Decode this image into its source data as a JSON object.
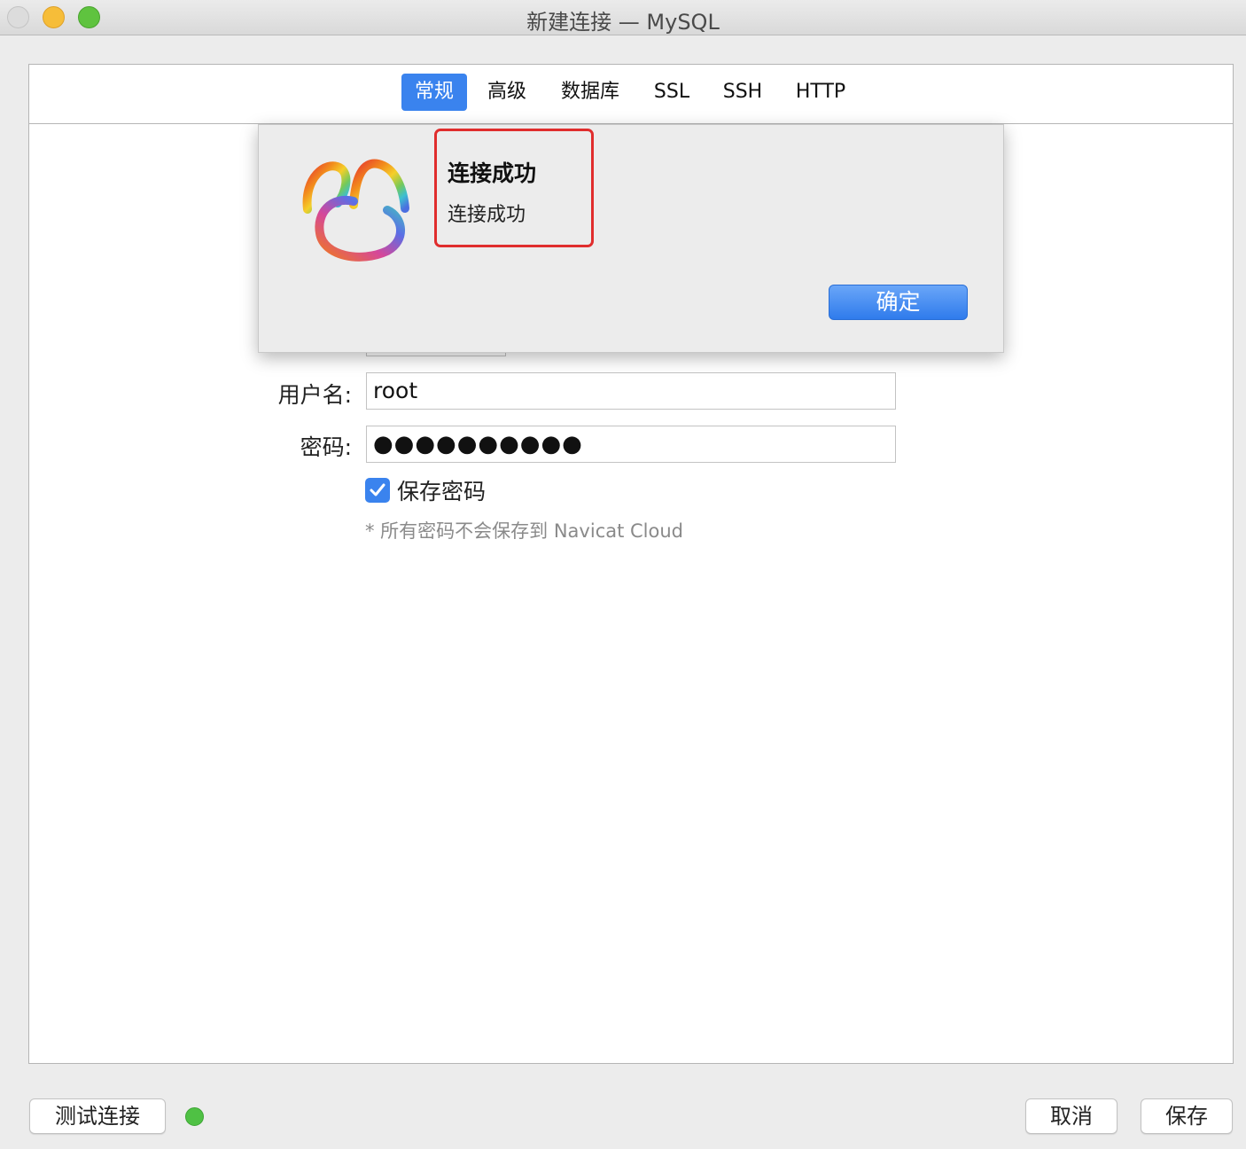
{
  "window": {
    "title": "新建连接 — MySQL"
  },
  "tabs": [
    {
      "label": "常规",
      "active": true
    },
    {
      "label": "高级",
      "active": false
    },
    {
      "label": "数据库",
      "active": false
    },
    {
      "label": "SSL",
      "active": false
    },
    {
      "label": "SSH",
      "active": false
    },
    {
      "label": "HTTP",
      "active": false
    }
  ],
  "form": {
    "username_label": "用户名:",
    "username_value": "root",
    "password_label": "密码:",
    "password_value": "●●●●●●●●●●",
    "save_password_label": "保存密码",
    "save_password_checked": true,
    "note": "* 所有密码不会保存到 Navicat Cloud"
  },
  "alert": {
    "title": "连接成功",
    "message": "连接成功",
    "ok_label": "确定",
    "icon": "navicat-logo-icon"
  },
  "footer": {
    "test_connection_label": "测试连接",
    "status_color": "#4fc144",
    "cancel_label": "取消",
    "save_label": "保存"
  },
  "colors": {
    "accent": "#3a83ee",
    "highlight": "#e02d2d"
  }
}
